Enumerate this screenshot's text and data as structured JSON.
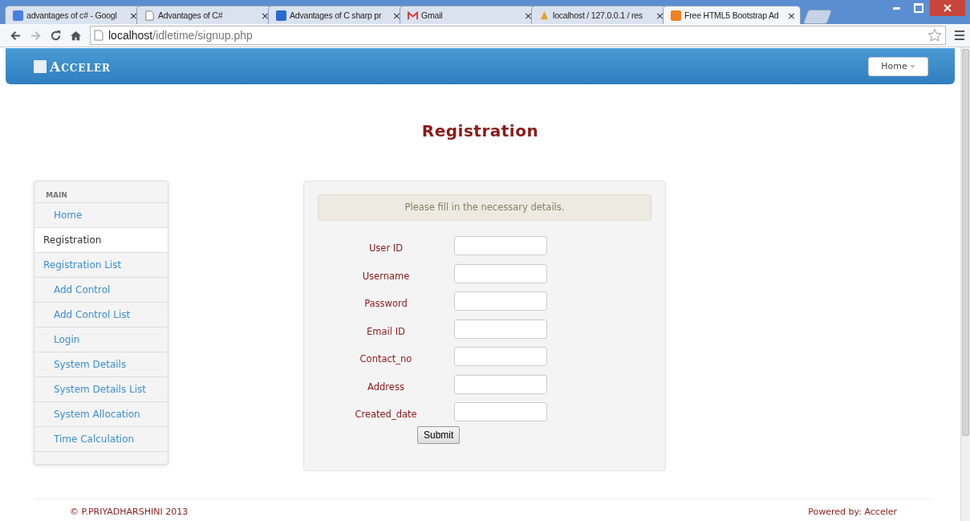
{
  "browser": {
    "tabs": [
      {
        "label": "advantages of c# - Googl",
        "selected": false
      },
      {
        "label": "Advantages of C#",
        "selected": false
      },
      {
        "label": "Advantages of C sharp pr",
        "selected": false
      },
      {
        "label": "Gmail",
        "selected": false
      },
      {
        "label": "localhost / 127.0.0.1 / res",
        "selected": false
      },
      {
        "label": "Free HTML5 Bootstrap Ad",
        "selected": true
      }
    ],
    "tab_close": "×",
    "address": {
      "host": "localhost",
      "path": "/idletime/signup.php"
    }
  },
  "navbar": {
    "brand": "Acceler",
    "menu": "Home"
  },
  "page_title": "Registration",
  "sidebar": {
    "heading": "MAIN",
    "items": [
      {
        "label": "Home",
        "kind": "sub",
        "selected": false
      },
      {
        "label": "Registration",
        "kind": "top",
        "selected": true
      },
      {
        "label": "Registration List",
        "kind": "top",
        "selected": false
      },
      {
        "label": "Add Control",
        "kind": "sub",
        "selected": false
      },
      {
        "label": "Add Control List",
        "kind": "sub",
        "selected": false
      },
      {
        "label": "Login",
        "kind": "sub",
        "selected": false
      },
      {
        "label": "System Details",
        "kind": "sub",
        "selected": false
      },
      {
        "label": "System Details List",
        "kind": "sub",
        "selected": false
      },
      {
        "label": "System Allocation",
        "kind": "sub",
        "selected": false
      },
      {
        "label": "Time Calculation",
        "kind": "sub",
        "selected": false
      }
    ]
  },
  "form": {
    "notice": "Please fill in the necessary details.",
    "fields": [
      {
        "label": "User ID"
      },
      {
        "label": "Username"
      },
      {
        "label": "Password"
      },
      {
        "label": "Email ID"
      },
      {
        "label": "Contact_no"
      },
      {
        "label": "Address"
      },
      {
        "label": "Created_date"
      }
    ],
    "submit": "Submit"
  },
  "footer": {
    "copyright": "© P.PRIYADHARSHINI 2013",
    "powered": "Powered by: Acceler"
  }
}
